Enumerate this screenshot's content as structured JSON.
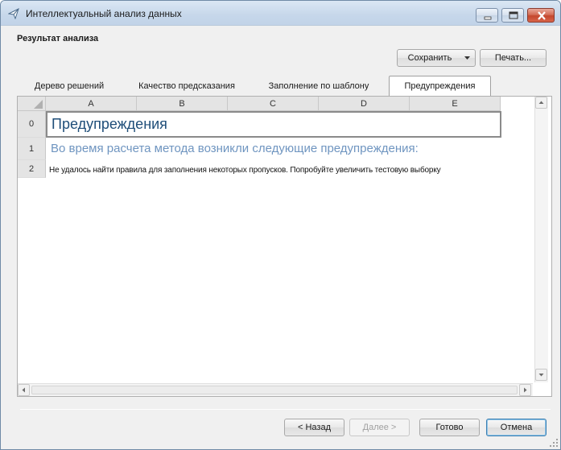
{
  "window": {
    "title": "Интеллектуальный анализ данных",
    "controls": {
      "minimize": "minimize",
      "maximize": "maximize",
      "close": "close"
    }
  },
  "header": {
    "section_title": "Результат анализа"
  },
  "toolbar": {
    "save_label": "Сохранить",
    "print_label": "Печать..."
  },
  "tabs": [
    {
      "label": "Дерево решений",
      "active": false
    },
    {
      "label": "Качество предсказания",
      "active": false
    },
    {
      "label": "Заполнение по шаблону",
      "active": false
    },
    {
      "label": "Предупреждения",
      "active": true
    }
  ],
  "sheet": {
    "columns": [
      "A",
      "B",
      "C",
      "D",
      "E"
    ],
    "rows": [
      "0",
      "1",
      "2"
    ],
    "cells": {
      "r0": "Предупреждения",
      "r1": "Во время расчета метода возникли следующие предупреждения:",
      "r2": "Не удалось найти правила для заполнения некоторых пропусков. Попробуйте увеличить тестовую выборку"
    }
  },
  "footer": {
    "back_label": "< Назад",
    "next_label": "Далее >",
    "done_label": "Готово",
    "cancel_label": "Отмена"
  },
  "colors": {
    "title_cell_text": "#1f4e79",
    "subtitle_text": "#6f95c0",
    "titlebar": "#c6d7ea"
  }
}
